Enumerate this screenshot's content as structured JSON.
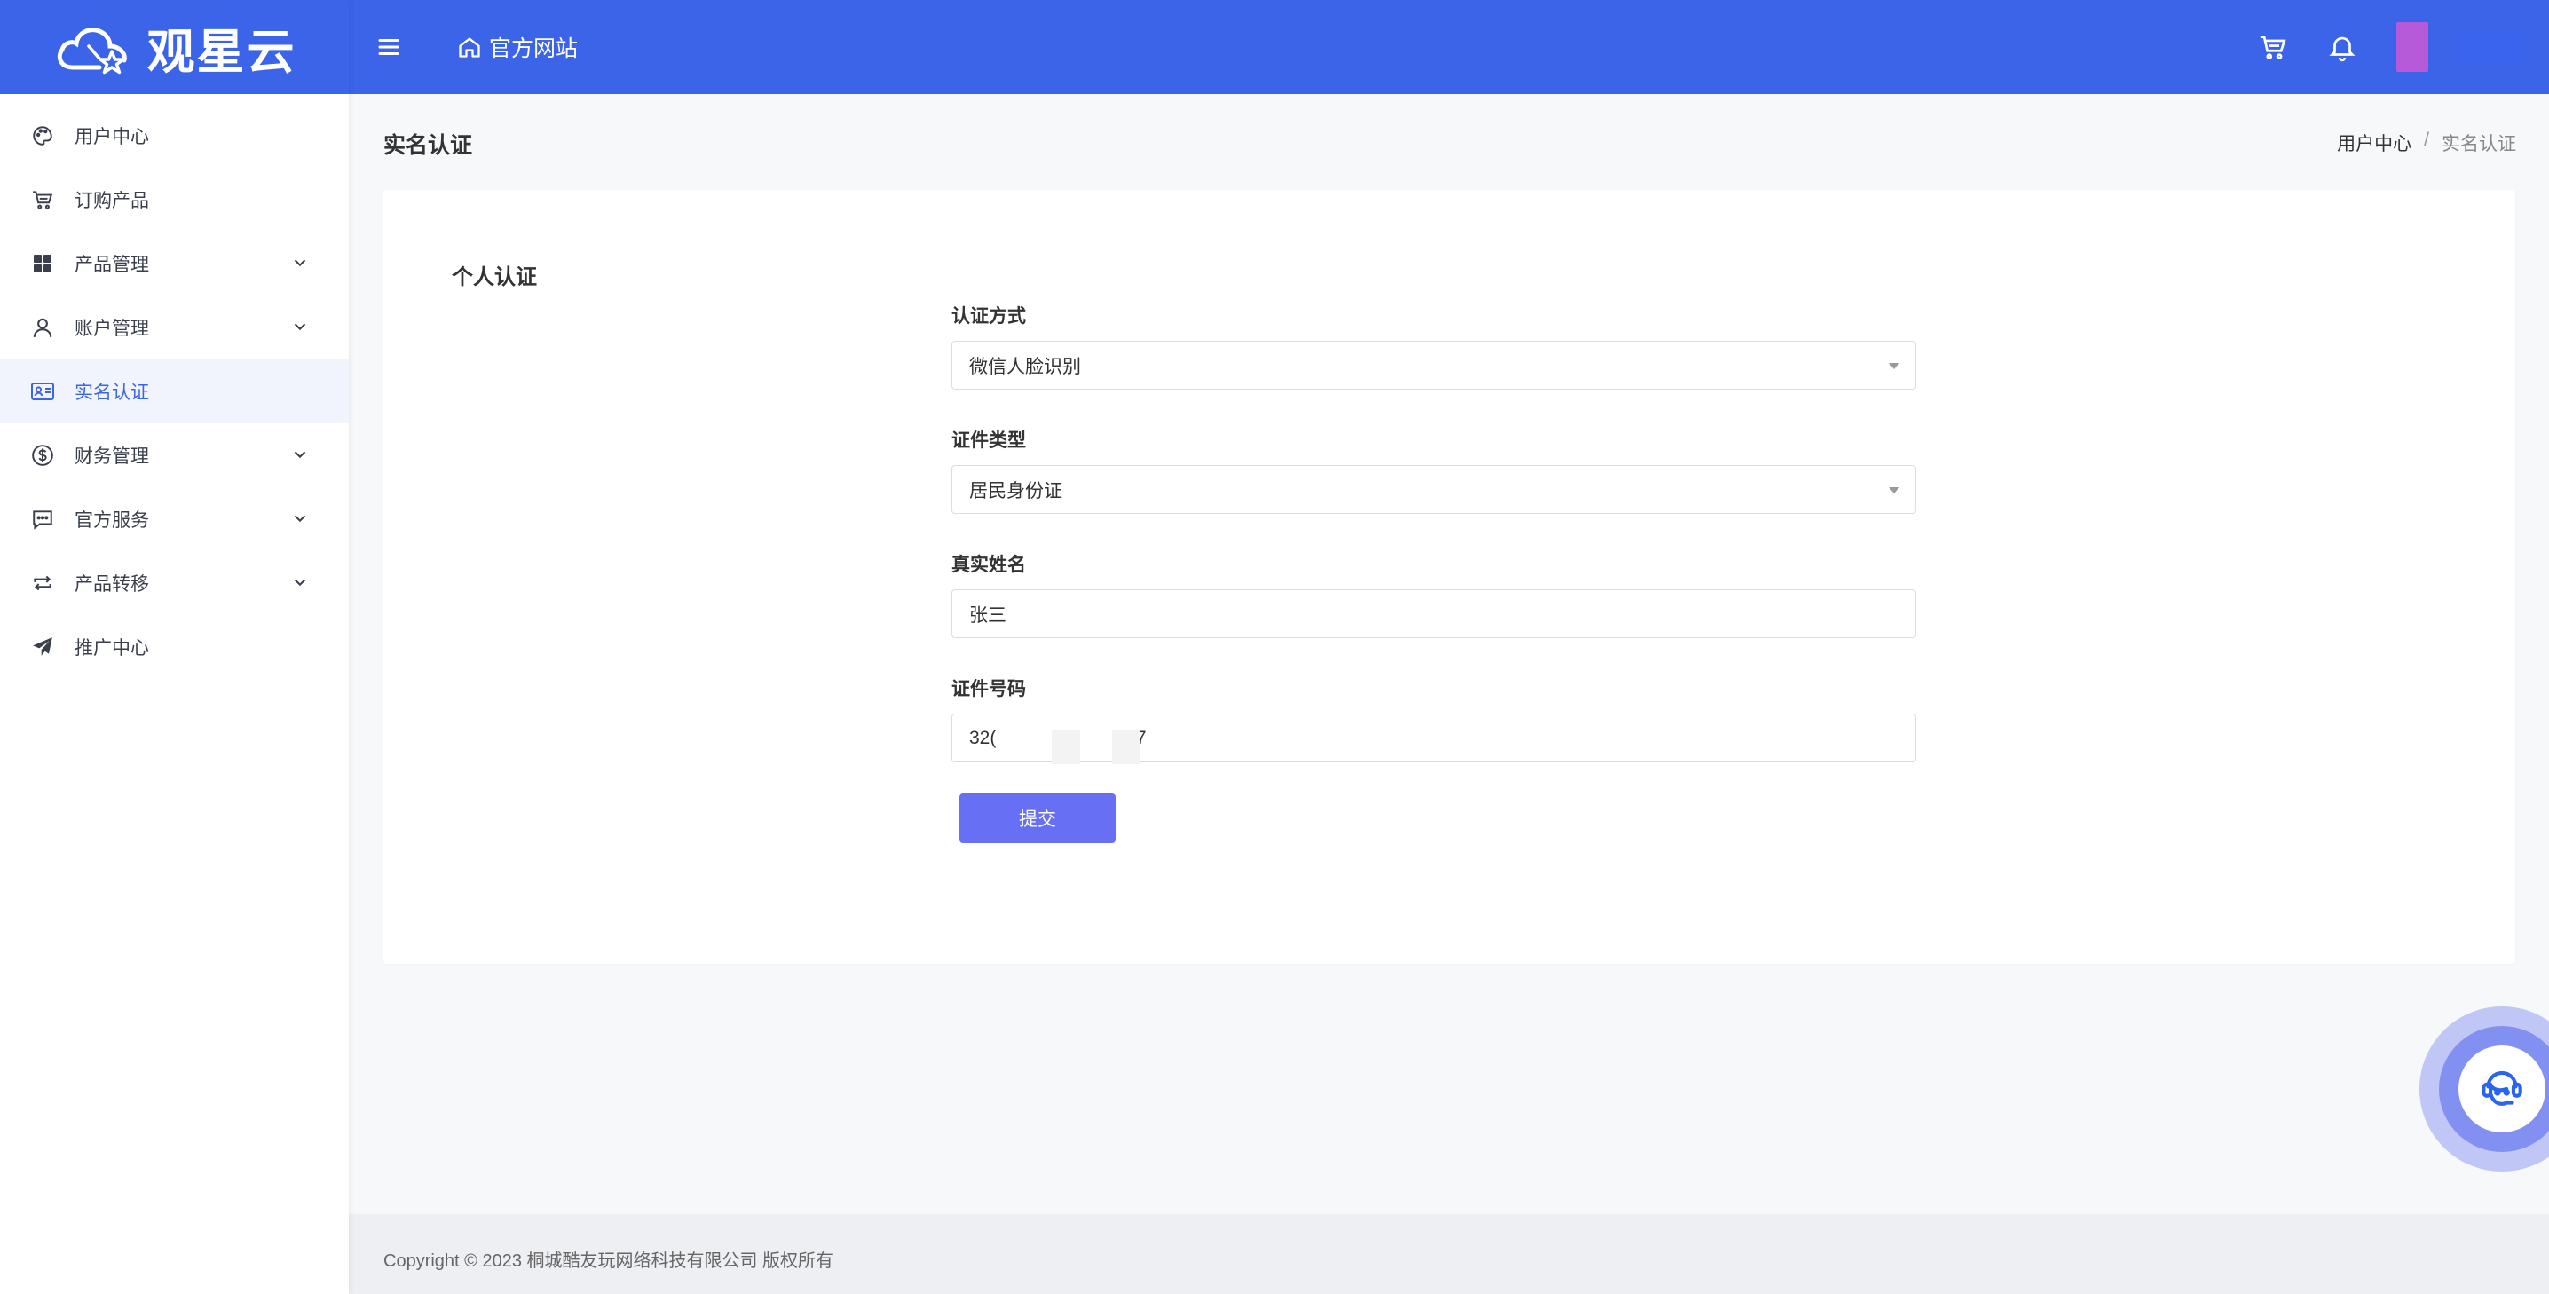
{
  "brand": {
    "logo_text": "观星云"
  },
  "header": {
    "home_link": "官方网站"
  },
  "sidebar": {
    "items": [
      {
        "label": "用户中心",
        "icon": "palette-icon",
        "expandable": false,
        "active": false
      },
      {
        "label": "订购产品",
        "icon": "cart-icon",
        "expandable": false,
        "active": false
      },
      {
        "label": "产品管理",
        "icon": "grid-icon",
        "expandable": true,
        "active": false
      },
      {
        "label": "账户管理",
        "icon": "user-icon",
        "expandable": true,
        "active": false
      },
      {
        "label": "实名认证",
        "icon": "id-card-icon",
        "expandable": false,
        "active": true
      },
      {
        "label": "财务管理",
        "icon": "dollar-icon",
        "expandable": true,
        "active": false
      },
      {
        "label": "官方服务",
        "icon": "chat-icon",
        "expandable": true,
        "active": false
      },
      {
        "label": "产品转移",
        "icon": "transfer-icon",
        "expandable": true,
        "active": false
      },
      {
        "label": "推广中心",
        "icon": "send-icon",
        "expandable": false,
        "active": false
      }
    ]
  },
  "page": {
    "title": "实名认证",
    "breadcrumb": {
      "home": "用户中心",
      "sep": "/",
      "current": "实名认证"
    }
  },
  "form": {
    "card_title": "个人认证",
    "method": {
      "label": "认证方式",
      "value": "微信人脸识别"
    },
    "id_type": {
      "label": "证件类型",
      "value": "居民身份证"
    },
    "real_name": {
      "label": "真实姓名",
      "value": "张三"
    },
    "id_number": {
      "label": "证件号码",
      "value": "32(                         37"
    },
    "submit_label": "提交"
  },
  "footer": {
    "copyright": "Copyright © 2023 桐城酷友玩网络科技有限公司 版权所有"
  },
  "colors": {
    "primary": "#3c64e9",
    "button": "#6770f4",
    "active_bg": "#f1f4fd"
  }
}
